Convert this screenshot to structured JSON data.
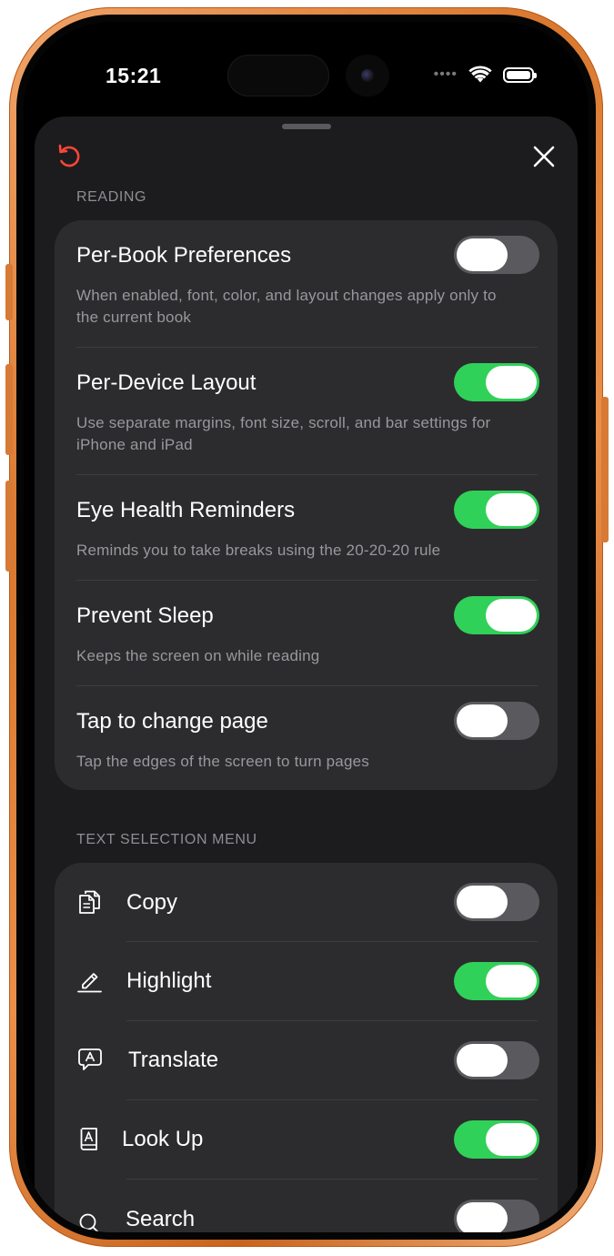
{
  "status_bar": {
    "time": "15:21",
    "dots": "••••"
  },
  "sheet": {
    "reading_section": {
      "header": "READING",
      "rows": [
        {
          "title": "Per-Book Preferences",
          "description": "When enabled, font, color, and layout changes apply only to the current book",
          "enabled": false
        },
        {
          "title": "Per-Device Layout",
          "description": "Use separate margins, font size, scroll, and bar settings for iPhone and iPad",
          "enabled": true
        },
        {
          "title": "Eye Health Reminders",
          "description": "Reminds you to take breaks using the 20-20-20 rule",
          "enabled": true
        },
        {
          "title": "Prevent Sleep",
          "description": "Keeps the screen on while reading",
          "enabled": true
        },
        {
          "title": "Tap to change page",
          "description": "Tap the edges of the screen to turn pages",
          "enabled": false
        }
      ]
    },
    "text_selection_section": {
      "header": "TEXT SELECTION MENU",
      "items": [
        {
          "label": "Copy",
          "icon": "copy-icon",
          "enabled": false
        },
        {
          "label": "Highlight",
          "icon": "highlight-icon",
          "enabled": true
        },
        {
          "label": "Translate",
          "icon": "translate-icon",
          "enabled": false
        },
        {
          "label": "Look Up",
          "icon": "dictionary-icon",
          "enabled": true
        },
        {
          "label": "Search",
          "icon": "search-icon",
          "enabled": false
        }
      ]
    }
  },
  "colors": {
    "accent_on": "#30d158",
    "toggle_off": "#5a5a5e",
    "reset_icon": "#ff453a",
    "sheet_bg": "#1c1c1e",
    "group_bg": "#2c2c2e"
  }
}
